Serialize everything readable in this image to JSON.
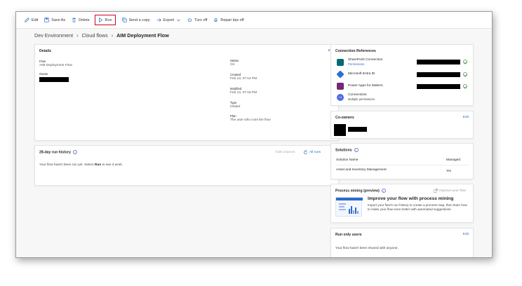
{
  "toolbar": {
    "edit": "Edit",
    "save_as": "Save As",
    "delete": "Delete",
    "run": "Run",
    "send_copy": "Send a copy",
    "export": "Export",
    "turn_off": "Turn off",
    "repair_tips": "Repair tips off"
  },
  "breadcrumb": {
    "env": "Dev Environment",
    "section": "Cloud flows",
    "current": "AIM Deployment Flow"
  },
  "details": {
    "title": "Details",
    "edit": "Edit",
    "flow_label": "Flow",
    "flow_value": "AIM Deployment Flow",
    "owner_label": "Owner",
    "status_label": "Status",
    "status_value": "On",
    "created_label": "Created",
    "created_value": "Feb 13, 07:14 PM",
    "modified_label": "Modified",
    "modified_value": "Feb 13, 07:15 PM",
    "type_label": "Type",
    "type_value": "Instant",
    "plan_label": "Plan",
    "plan_value": "The user who runs the flow"
  },
  "run_history": {
    "title": "28-day run history",
    "edit_columns": "Edit columns",
    "all_runs": "All runs",
    "empty_prefix": "Your flow hasn't been run yet. Select ",
    "empty_bold": "Run",
    "empty_suffix": " to see it work."
  },
  "connections": {
    "title": "Connection References",
    "items": [
      {
        "name": "SharePoint Connection",
        "sub": "Permissions",
        "color": "#036c70"
      },
      {
        "name": "Microsoft Entra ID",
        "sub": "",
        "color": "#2f6ed3"
      },
      {
        "name": "Power Apps for Makers",
        "sub": "",
        "color": "#742774"
      },
      {
        "name": "Connections",
        "sub": "Multiple permissions",
        "color": "#4f6bed",
        "badge": "+1"
      }
    ]
  },
  "coowners": {
    "title": "Co-owners",
    "edit": "Edit"
  },
  "solutions": {
    "title": "Solutions",
    "col_name": "Solution Name",
    "col_managed": "Managed",
    "row_name": "Asset and Inventory Management",
    "row_managed": "Yes"
  },
  "process_mining": {
    "title": "Process mining (preview)",
    "improve_link": "Improve your flow",
    "heading": "Improve your flow with process mining",
    "body": "Import your flow's run history to create a process map, then learn how to make your flow even better with automated suggestions."
  },
  "run_only": {
    "title": "Run only users",
    "edit": "Edit",
    "empty": "Your flow hasn't been shared with anyone."
  },
  "colors": {
    "accent": "#2a6cc8",
    "run_highlight": "#d1001f"
  }
}
